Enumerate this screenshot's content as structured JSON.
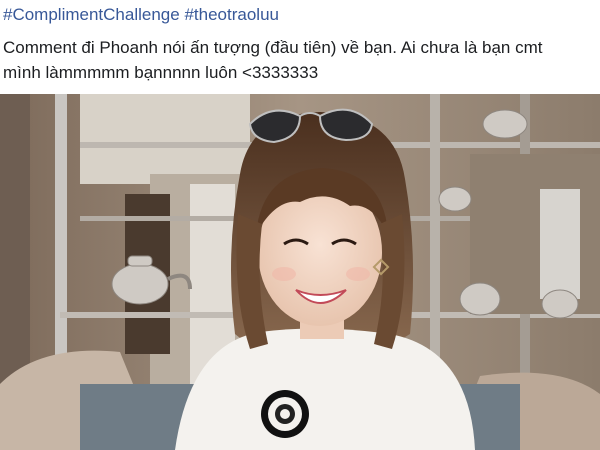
{
  "post": {
    "hashtags": [
      "#ComplimentChallenge",
      "#theotraoluu"
    ],
    "caption_line1": "Comment đi Phoanh nói ấn tượng (đầu tiên) về bạn. Ai chưa là bạn cmt",
    "caption_line2": "mình làmmmmm bạnnnnn luôn <3333333"
  },
  "photo": {
    "icon": "photo-of-smiling-woman",
    "colors": {
      "hair": "#5a3a24",
      "shirt": "#f4f2ee",
      "skin": "#f2d6c4",
      "background": "#8a7b6c"
    }
  }
}
